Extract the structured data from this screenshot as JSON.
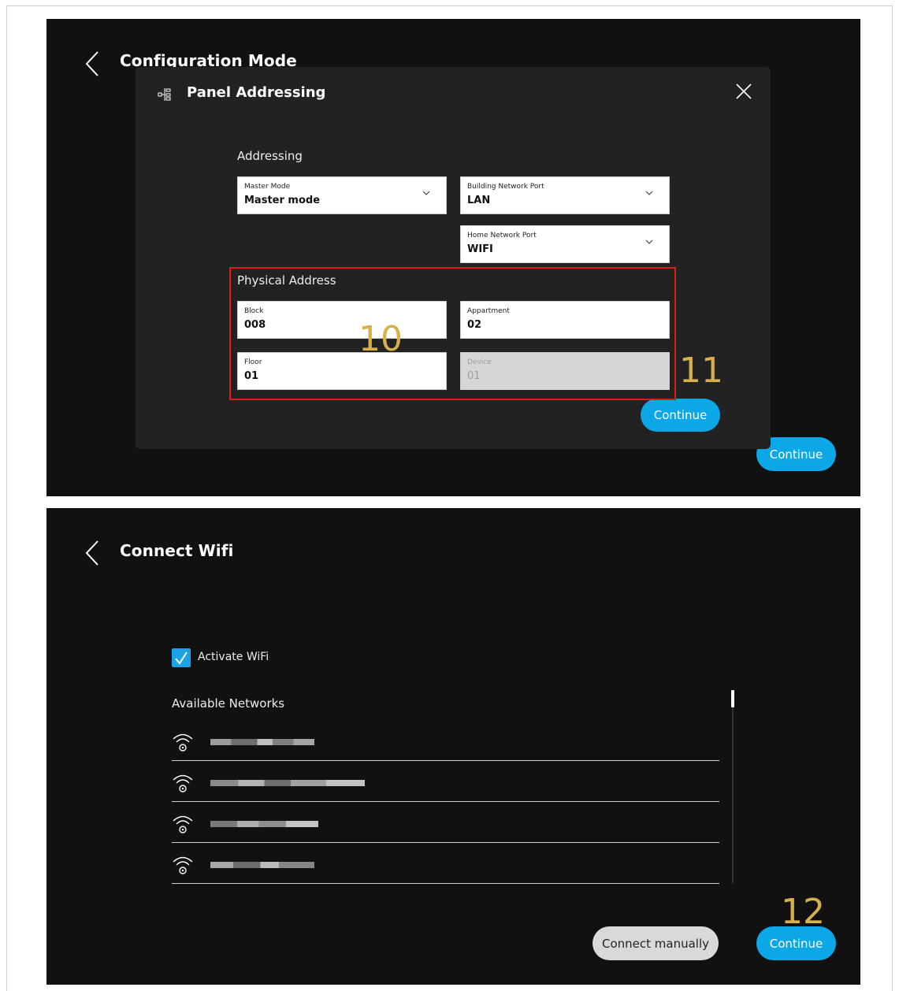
{
  "screen1": {
    "title": "Configuration Mode",
    "background_continue": "Continue",
    "dialog": {
      "title": "Panel Addressing",
      "addressing_heading": "Addressing",
      "master_mode": {
        "label": "Master Mode",
        "value": "Master mode"
      },
      "building_network_port": {
        "label": "Building Network Port",
        "value": "LAN"
      },
      "home_network_port": {
        "label": "Home Network Port",
        "value": "WIFI"
      },
      "physical_address_heading": "Physical Address",
      "block": {
        "label": "Block",
        "value": "008"
      },
      "appartment": {
        "label": "Appartment",
        "value": "02"
      },
      "floor": {
        "label": "Floor",
        "value": "01"
      },
      "device": {
        "label": "Device",
        "value": "01"
      },
      "continue": "Continue"
    },
    "callouts": {
      "fields": "10",
      "continue": "11"
    }
  },
  "screen2": {
    "title": "Connect Wifi",
    "activate_wifi_label": "Activate WiFi",
    "activate_wifi_checked": true,
    "available_networks_heading": "Available Networks",
    "connect_manually": "Connect manually",
    "continue": "Continue",
    "callout": "12"
  },
  "colors": {
    "accent_blue": "#0ca7e6",
    "callout_gold": "#d7b04a",
    "highlight_red": "#e01b1b",
    "screen_bg": "#111111",
    "dialog_bg": "#222222"
  }
}
